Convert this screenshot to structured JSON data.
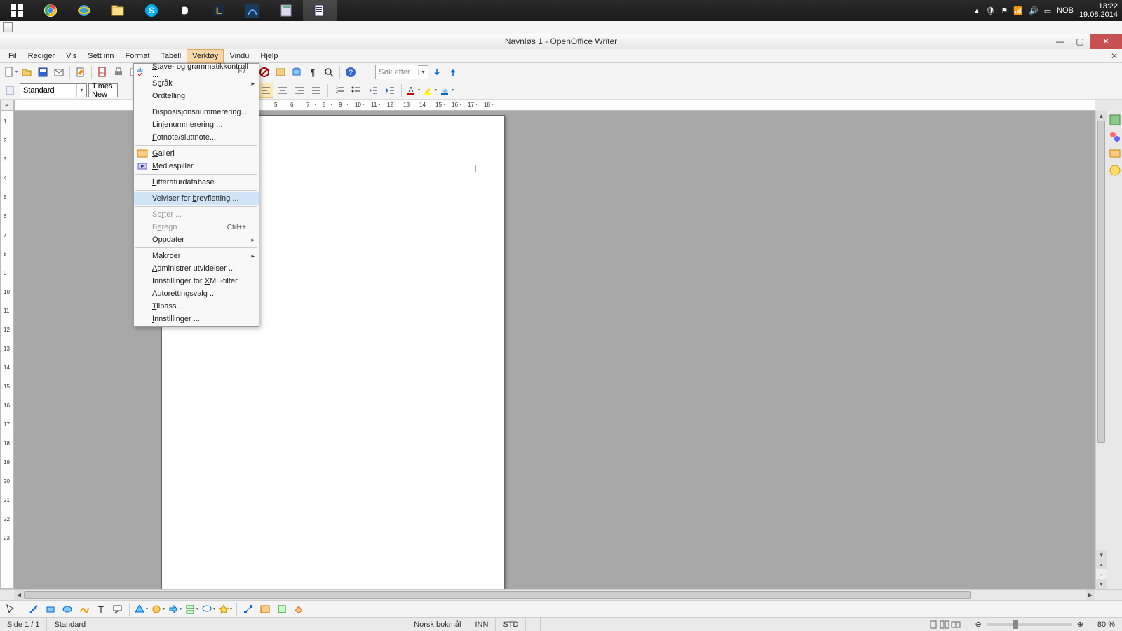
{
  "system": {
    "language_indicator": "NOB",
    "time": "13:22",
    "date": "19.08.2014"
  },
  "window": {
    "title": "Navnløs 1 - OpenOffice Writer",
    "close_doc_tooltip": "×"
  },
  "menu": {
    "items": [
      "Fil",
      "Rediger",
      "Vis",
      "Sett inn",
      "Format",
      "Tabell",
      "Verktøy",
      "Vindu",
      "Hjelp"
    ],
    "open_index": 6
  },
  "dropdown": {
    "items": [
      {
        "label_pre": "",
        "label_u": "S",
        "label_post": "tave- og grammatikkontroll ...",
        "shortcut": "F7",
        "icon": "abc",
        "submenu": false
      },
      {
        "label_pre": "S",
        "label_u": "p",
        "label_post": "råk",
        "submenu": true
      },
      {
        "label_pre": "Ordtelling",
        "label_u": "",
        "label_post": "",
        "submenu": false
      },
      {
        "sep": true
      },
      {
        "label_pre": "Disposisjonsnummerering...",
        "label_u": "",
        "label_post": ""
      },
      {
        "label_pre": "Linjenummerering ...",
        "label_u": "",
        "label_post": ""
      },
      {
        "label_pre": "",
        "label_u": "F",
        "label_post": "otnote/sluttnote..."
      },
      {
        "sep": true
      },
      {
        "label_pre": "",
        "label_u": "G",
        "label_post": "alleri",
        "icon": "gallery"
      },
      {
        "label_pre": "",
        "label_u": "M",
        "label_post": "ediespiller",
        "icon": "media"
      },
      {
        "sep": true
      },
      {
        "label_pre": "",
        "label_u": "L",
        "label_post": "itteraturdatabase"
      },
      {
        "sep": true
      },
      {
        "label_pre": "Veiviser for ",
        "label_u": "b",
        "label_post": "revfletting ...",
        "highlight": true
      },
      {
        "sep": true
      },
      {
        "label_pre": "So",
        "label_u": "r",
        "label_post": "ter ...",
        "disabled": true
      },
      {
        "label_pre": "B",
        "label_u": "e",
        "label_post": "regn",
        "shortcut": "Ctrl++",
        "disabled": true
      },
      {
        "label_pre": "",
        "label_u": "O",
        "label_post": "ppdater",
        "submenu": true
      },
      {
        "sep": true
      },
      {
        "label_pre": "",
        "label_u": "M",
        "label_post": "akroer",
        "submenu": true
      },
      {
        "label_pre": "",
        "label_u": "A",
        "label_post": "dministrer utvidelser ..."
      },
      {
        "label_pre": "Innstillinger for ",
        "label_u": "X",
        "label_post": "ML-filter ..."
      },
      {
        "label_pre": "",
        "label_u": "A",
        "label_post": "utorettingsvalg ..."
      },
      {
        "label_pre": "",
        "label_u": "T",
        "label_post": "ilpass..."
      },
      {
        "label_pre": "",
        "label_u": "I",
        "label_post": "nnstillinger ..."
      }
    ]
  },
  "toolbar": {
    "search_placeholder": "Søk etter"
  },
  "format_bar": {
    "style": "Standard",
    "font": "Times New"
  },
  "ruler": {
    "h_marks": [
      "5",
      "6",
      "7",
      "8",
      "9",
      "10",
      "11",
      "12",
      "13",
      "14",
      "15",
      "16",
      "17",
      "18"
    ],
    "v_marks": [
      "1",
      "2",
      "3",
      "4",
      "5",
      "6",
      "7",
      "8",
      "9",
      "10",
      "11",
      "12",
      "13",
      "14",
      "15",
      "16",
      "17",
      "18",
      "19",
      "20",
      "21",
      "22",
      "23"
    ]
  },
  "status": {
    "page": "Side 1 / 1",
    "style": "Standard",
    "language": "Norsk bokmål",
    "insert": "INN",
    "selmode": "STD",
    "zoom": "80 %"
  }
}
